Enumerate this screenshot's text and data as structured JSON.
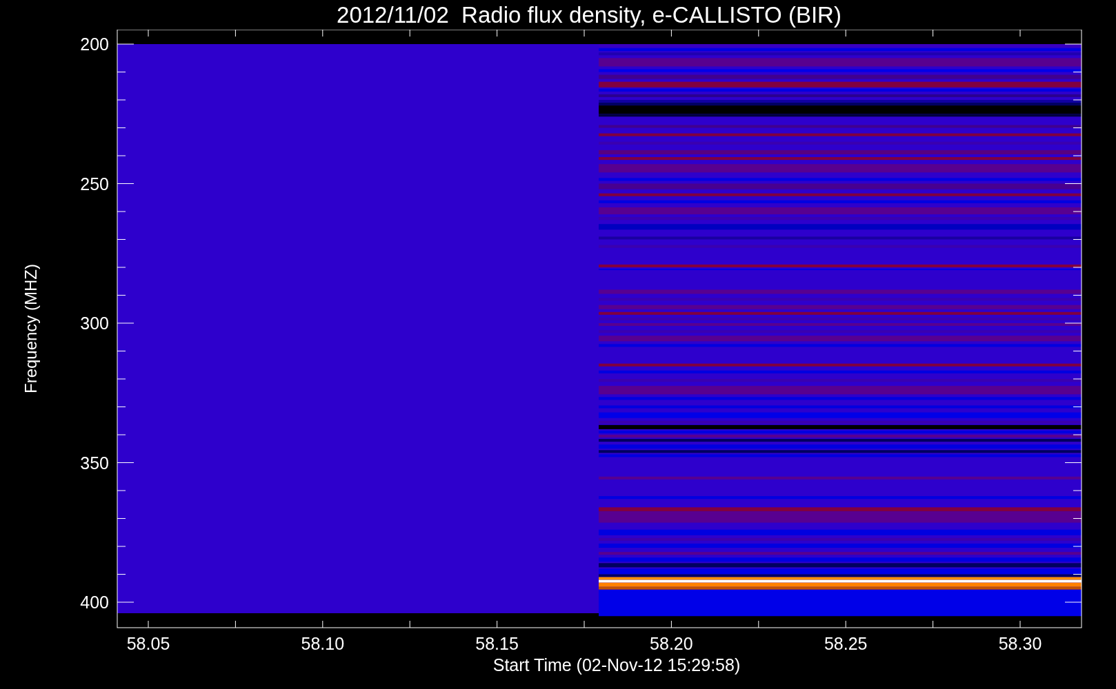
{
  "title": "2012/11/02  Radio flux density, e-CALLISTO (BIR)",
  "y_axis": {
    "label": "Frequency (MHZ)",
    "ticks": [
      "200",
      "250",
      "300",
      "350",
      "400"
    ]
  },
  "x_axis": {
    "label": "Start Time (02-Nov-12 15:29:58)",
    "ticks": [
      "58.05",
      "58.10",
      "58.15",
      "58.20",
      "58.25",
      "58.30"
    ]
  }
}
